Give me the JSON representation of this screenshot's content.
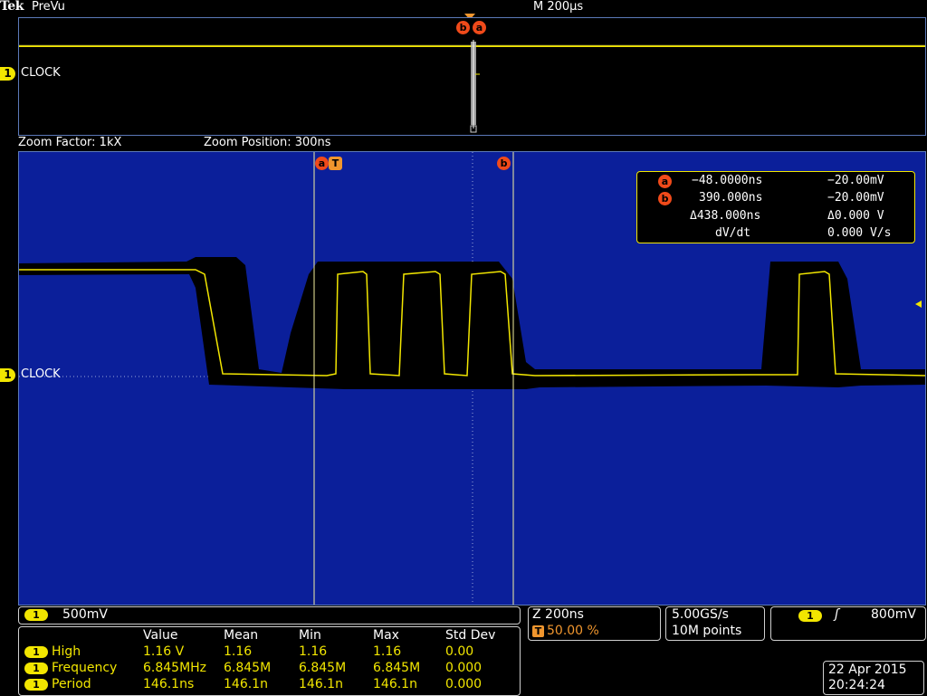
{
  "brand": "Tek",
  "acq_status": "PreVu",
  "timebase": "M 200µs",
  "overview": {
    "cursor_b": "b",
    "cursor_a": "a"
  },
  "channel1": {
    "number": "1",
    "label": "CLOCK"
  },
  "zoom": {
    "factor": "Zoom Factor: 1kX",
    "position": "Zoom Position: 300ns"
  },
  "cursors": {
    "a": {
      "badge": "a",
      "time": "−48.0000ns",
      "volt": "−20.00mV"
    },
    "b": {
      "badge": "b",
      "time": "390.000ns",
      "volt": "−20.00mV"
    },
    "delta_time": "Δ438.000ns",
    "delta_volt": "Δ0.000 V",
    "dvdt_label": "dV/dt",
    "dvdt_value": "0.000 V/s",
    "trigger_marker": "T"
  },
  "vertical": {
    "channel": "1",
    "scale": "500mV"
  },
  "zoom_box": {
    "scale": "Z 200ns",
    "trigger_badge": "T",
    "trigger_pos": "50.00 %"
  },
  "sampling": {
    "rate": "5.00GS/s",
    "points": "10M points"
  },
  "trigger": {
    "channel": "1",
    "slope_icon": "rising-edge",
    "slope_glyph": "ʃ",
    "level": "800mV"
  },
  "measurements": {
    "headers": [
      "Value",
      "Mean",
      "Min",
      "Max",
      "Std Dev"
    ],
    "rows": [
      {
        "channel": "1",
        "name": "High",
        "value": "1.16 V",
        "mean": "1.16",
        "min": "1.16",
        "max": "1.16",
        "std": "0.00"
      },
      {
        "channel": "1",
        "name": "Frequency",
        "value": "6.845MHz",
        "mean": "6.845M",
        "min": "6.845M",
        "max": "6.845M",
        "std": "0.000"
      },
      {
        "channel": "1",
        "name": "Period",
        "value": "146.1ns",
        "mean": "146.1n",
        "min": "146.1n",
        "max": "146.1n",
        "std": "0.000"
      }
    ]
  },
  "datetime": {
    "date": "22 Apr 2015",
    "time": "20:24:24"
  },
  "colors": {
    "trace": "#f2e600",
    "screen": "#0b1f9a",
    "cursor": "#f04a1a",
    "accent": "#f0962e"
  }
}
